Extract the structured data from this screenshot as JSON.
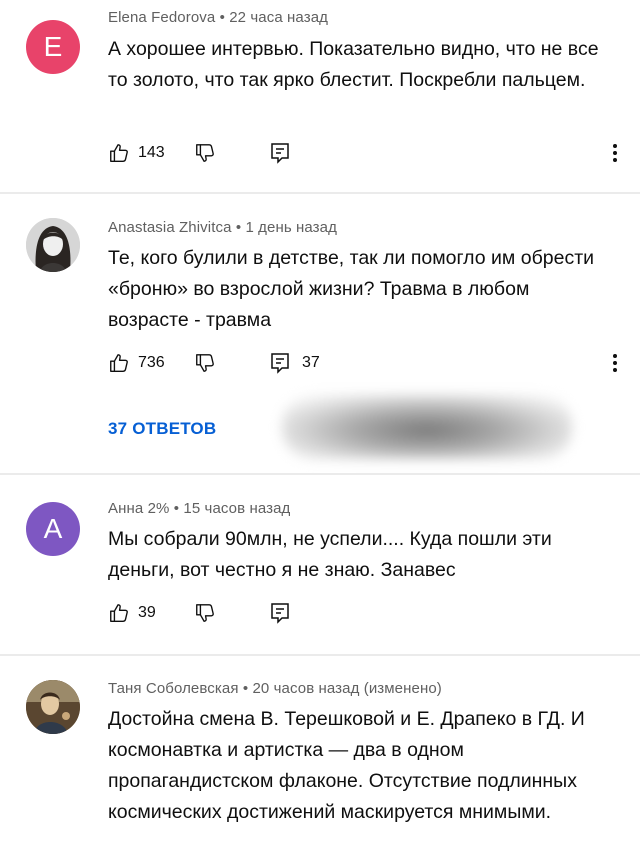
{
  "comments": [
    {
      "avatar_letter": "E",
      "avatar_color": "#e8436a",
      "author": "Elena Fedorova",
      "time": "22 часа назад",
      "text": "А хорошее интервью. Показательно видно, что не все то золото, что так ярко блестит. Поскребли пальцем.",
      "likes": "143",
      "replies_count": ""
    },
    {
      "avatar_letter": "",
      "avatar_color": "#cfcfcf",
      "author": "Anastasia Zhivitca",
      "time": "1 день назад",
      "text": "Те, кого булили в детстве, так ли помогло им обрести «броню» во взрослой жизни? Травма в любом возрасте - травма",
      "likes": "736",
      "replies_count": "37",
      "replies_button": "37 ОТВЕТОВ"
    },
    {
      "avatar_letter": "A",
      "avatar_color": "#7e57c2",
      "author": "Анна 2%",
      "time": "15 часов назад",
      "text": "Мы собрали 90млн, не успели.... Куда пошли эти деньги, вот честно я не знаю. Занавес",
      "likes": "39",
      "replies_count": ""
    },
    {
      "avatar_letter": "",
      "avatar_color": "#8b6a44",
      "author": "Таня Соболевская",
      "time": "20 часов назад (изменено)",
      "text": "Достойна смена В. Терешковой и Е. Драпеко в ГД. И космонавтка и артистка — два в одном пропагандистском флаконе. Отсутствие подлинных космических достижений маскируется мнимыми.",
      "likes": "",
      "replies_count": ""
    }
  ],
  "separator": "•",
  "icons": {
    "like": "thumbs-up-icon",
    "dislike": "thumbs-down-icon",
    "reply": "reply-comment-icon",
    "menu": "more-vert-icon"
  }
}
